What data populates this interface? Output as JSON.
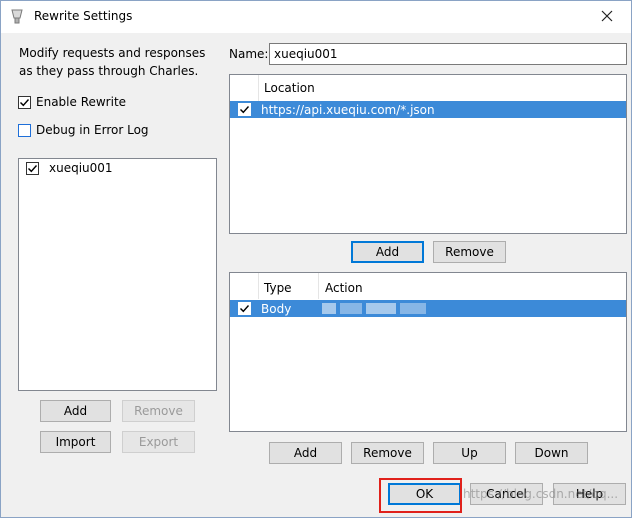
{
  "window": {
    "title": "Rewrite Settings",
    "icons": {
      "app": "charles-app-icon",
      "close": "close-icon"
    }
  },
  "left": {
    "description_line1": "Modify requests and responses",
    "description_line2": "as they pass through Charles.",
    "enable_rewrite": {
      "label": "Enable Rewrite",
      "checked": true
    },
    "debug_error_log": {
      "label": "Debug in Error Log",
      "checked": false
    },
    "sets": [
      {
        "name": "xueqiu001",
        "checked": true
      }
    ],
    "buttons": {
      "add": "Add",
      "remove": "Remove",
      "import": "Import",
      "export": "Export"
    }
  },
  "right": {
    "name_label": "Name:",
    "name_value": "xueqiu001",
    "locations": {
      "header": "Location",
      "rows": [
        {
          "value": "https://api.xueqiu.com/*.json",
          "checked": true
        }
      ],
      "buttons": {
        "add": "Add",
        "remove": "Remove"
      }
    },
    "rules": {
      "headers": {
        "type": "Type",
        "action": "Action"
      },
      "rows": [
        {
          "type": "Body",
          "checked": true
        }
      ],
      "buttons": {
        "add": "Add",
        "remove": "Remove",
        "up": "Up",
        "down": "Down"
      }
    }
  },
  "footer": {
    "ok": "OK",
    "cancel": "Cancel",
    "help": "Help",
    "watermark": "https://blog.csdn.net/qq..."
  },
  "colors": {
    "selection": "#3c8ad8",
    "highlight_box": "#e0211b",
    "default_button_border": "#0078d7"
  }
}
